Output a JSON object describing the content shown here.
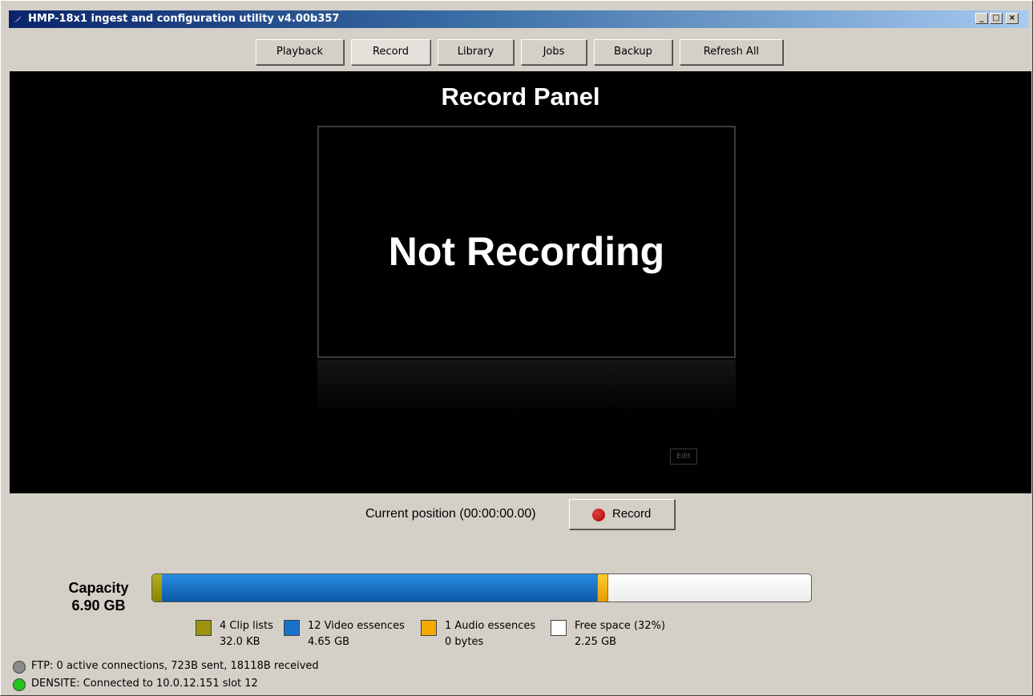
{
  "window": {
    "title": "HMP-18x1 ingest and configuration utility v4.00b357",
    "controls": {
      "minimize": "_",
      "maximize": "□",
      "close": "×"
    }
  },
  "nav": {
    "tabs": [
      {
        "label": "Playback"
      },
      {
        "label": "Record",
        "active": true
      },
      {
        "label": "Library"
      },
      {
        "label": "Jobs"
      },
      {
        "label": "Backup"
      },
      {
        "label": "Refresh All"
      }
    ]
  },
  "panel": {
    "title": "Record Panel",
    "status": "Not Recording",
    "edit_label": "Edit"
  },
  "record": {
    "current_position": "Current position (00:00:00.00)",
    "button_label": "Record"
  },
  "capacity": {
    "label": "Capacity",
    "total": "6.90 GB",
    "fractions": {
      "clip": 0.015,
      "video": 0.66,
      "audio": 0.015,
      "free": 0.31
    },
    "legend": [
      {
        "line1": "4 Clip lists",
        "line2": "32.0 KB",
        "color": "#9c9410"
      },
      {
        "line1": "12 Video essences",
        "line2": "4.65 GB",
        "color": "#1673c9"
      },
      {
        "line1": "1 Audio essences",
        "line2": "0 bytes",
        "color": "#f5a800"
      },
      {
        "line1": "Free space (32%)",
        "line2": "2.25 GB",
        "color": "#ffffff"
      }
    ]
  },
  "status": {
    "ftp": {
      "text": "FTP: 0 active connections, 723B sent, 18118B received",
      "color": "#8a8a8a"
    },
    "densite": {
      "text": "DENSITE: Connected to 10.0.12.151 slot 12",
      "color": "#22c41c"
    }
  }
}
